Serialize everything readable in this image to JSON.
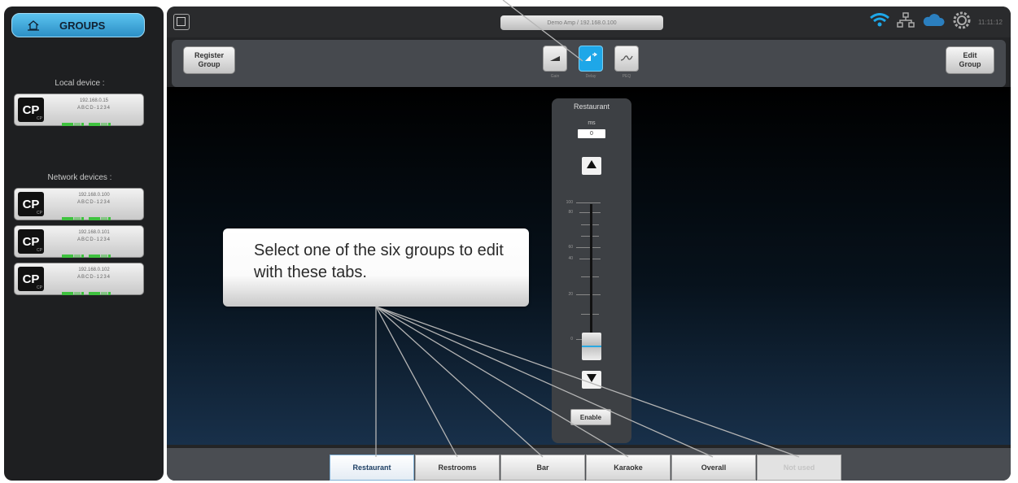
{
  "sidebar": {
    "groups_button": "GROUPS",
    "local_label": "Local device :",
    "network_label": "Network devices :",
    "local_devices": [
      {
        "logo": "CP",
        "ip": "192.168.0.15",
        "channels": "ABCD-1234"
      }
    ],
    "network_devices": [
      {
        "logo": "CP",
        "ip": "192.168.0.100",
        "channels": "ABCD-1234"
      },
      {
        "logo": "CP",
        "ip": "192.168.0.101",
        "channels": "ABCD-1234"
      },
      {
        "logo": "CP",
        "ip": "192.168.0.102",
        "channels": "ABCD-1234"
      }
    ]
  },
  "titlebar": {
    "device_title": "Demo Amp / 192.168.0.100",
    "clock": "11:11:12"
  },
  "toolbar": {
    "register_group": "Register\nGroup",
    "edit_group": "Edit\nGroup",
    "modes": [
      {
        "label": "Gain",
        "icon": "gain-icon"
      },
      {
        "label": "Delay",
        "icon": "delay-icon"
      },
      {
        "label": "PEQ",
        "icon": "peq-icon"
      }
    ],
    "active_mode": "Delay"
  },
  "strip": {
    "name": "Restaurant",
    "channel_label": "ms",
    "value": "0",
    "enable": "Enable",
    "scale": [
      "100",
      "80",
      "60",
      "40",
      "20",
      "0"
    ]
  },
  "tabs": [
    {
      "label": "Restaurant",
      "state": "active"
    },
    {
      "label": "Restrooms",
      "state": "normal"
    },
    {
      "label": "Bar",
      "state": "normal"
    },
    {
      "label": "Karaoke",
      "state": "normal"
    },
    {
      "label": "Overall",
      "state": "normal"
    },
    {
      "label": "Not used",
      "state": "disabled"
    }
  ],
  "callout": {
    "text": "Select one of the six groups to edit with these tabs."
  },
  "colors": {
    "accent": "#1ea7e8",
    "background": "#232426",
    "meter_green": "#3fc23f"
  }
}
